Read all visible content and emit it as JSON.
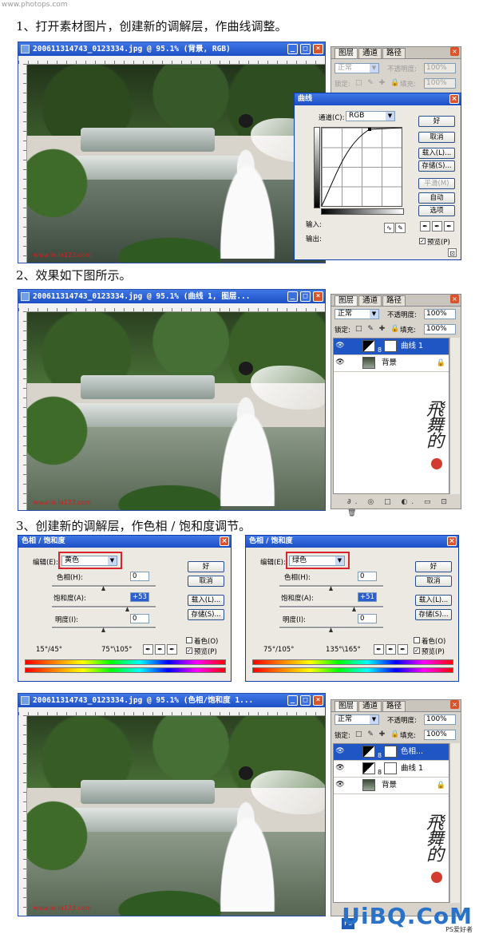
{
  "watermark_top": "www.photops.com",
  "steps": [
    "1、打开素材图片，创建新的调解层，作曲线调整。",
    "2、效果如下图所示。",
    "3、创建新的调解层，作色相 / 饱和度调节。"
  ],
  "doc_windows": [
    {
      "title": "200611314743_0123334.jpg @ 95.1% (背景, RGB)"
    },
    {
      "title": "200611314743_0123334.jpg @ 95.1% (曲线 1, 图层..."
    },
    {
      "title": "200611314743_0123334.jpg @ 95.1% (色相/饱和度 1..."
    }
  ],
  "photo_watermark": "www.ie.la123.com",
  "panel": {
    "tabs": [
      "图层",
      "通道",
      "路径"
    ],
    "blend_mode": "正常",
    "opacity_label": "不透明度:",
    "opacity_value": "100%",
    "lock_label": "锁定:",
    "fill_label": "填充:",
    "fill_value": "100%",
    "lock_icons": "□ ✎ ✚ 🔒",
    "bottom_icons": "∂. ◎ □ ◐. ▭ ⊡ 🗑"
  },
  "layers_panel2": [
    {
      "name": "曲线 1",
      "selected": true
    },
    {
      "name": "背景",
      "selected": false
    }
  ],
  "layers_panel3": [
    {
      "name": "色相...",
      "selected": true
    },
    {
      "name": "曲线 1",
      "selected": false
    },
    {
      "name": "背景",
      "selected": false
    }
  ],
  "curves": {
    "title": "曲线",
    "channel_label": "通道(C):",
    "channel_value": "RGB",
    "input_label": "输入:",
    "output_label": "输出:",
    "buttons": [
      "好",
      "取消",
      "载入(L)...",
      "存储(S)...",
      "平滑(M)",
      "自动",
      "选项"
    ],
    "preview_label": "预览(P)"
  },
  "hue_sat": [
    {
      "title": "色相 / 饱和度",
      "edit_label": "编辑(E):",
      "edit_value": "黄色",
      "hue_label": "色相(H):",
      "hue_value": "0",
      "sat_label": "饱和度(A):",
      "sat_value": "+53",
      "light_label": "明度(I):",
      "light_value": "0",
      "range_left": "15°/45°",
      "range_right": "75°\\105°",
      "buttons": [
        "好",
        "取消",
        "载入(L)...",
        "存储(S)..."
      ],
      "colorize_label": "着色(O)",
      "preview_label": "预览(P)"
    },
    {
      "title": "色相 / 饱和度",
      "edit_label": "编辑(E):",
      "edit_value": "绿色",
      "hue_label": "色相(H):",
      "hue_value": "0",
      "sat_label": "饱和度(A):",
      "sat_value": "+51",
      "light_label": "明度(I):",
      "light_value": "0",
      "range_left": "75°/105°",
      "range_right": "135°\\165°",
      "buttons": [
        "好",
        "取消",
        "载入(L)...",
        "存储(S)..."
      ],
      "colorize_label": "着色(O)",
      "preview_label": "预览(P)"
    }
  ],
  "footer": {
    "logo": "UiBQ.CoM",
    "sub": "PS爱好者"
  }
}
